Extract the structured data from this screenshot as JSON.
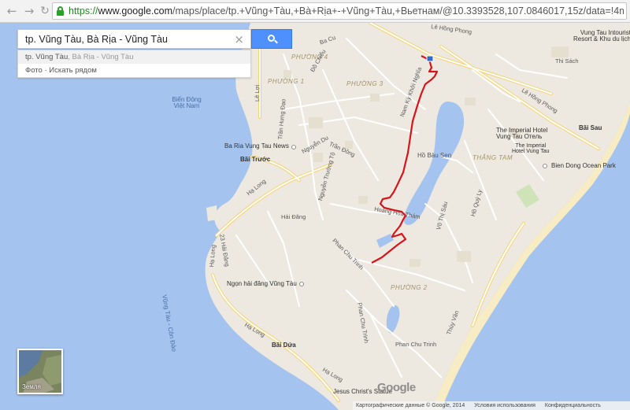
{
  "browser": {
    "back_icon": "back-arrow-icon",
    "forward_icon": "forward-arrow-icon",
    "url_scheme": "https://",
    "url_host": "www.google.com",
    "url_path": "/maps/place/tp.+Vũng+Tàu,+Bà+Rịa+-+Vũng+Tàu,+Вьетнам/@10.3393528,107.0846017,15z/data=!4m2!3m1!1s0x3175..."
  },
  "search": {
    "query": "tp. Vũng Tàu, Bà Rịa - Vũng Tàu",
    "clear_icon": "close-icon",
    "button_icon": "search-icon",
    "suggestions": [
      {
        "main": "tp. Vũng Tàu",
        "secondary": ", Bà Rịa - Vũng Tàu"
      },
      {
        "main": "Фото · Искать рядом",
        "secondary": ""
      }
    ]
  },
  "map": {
    "water_labels": [
      "Biển Đông Việt Nam",
      "Vũng Tàu - Côn Đảo",
      "Hồ Bàu Sen"
    ],
    "districts": [
      "PHƯỜNG 4",
      "PHƯỜNG 1",
      "PHƯỜNG 3",
      "PHƯỜNG 2",
      "THẮNG TAM"
    ],
    "streets": {
      "le_hong_phong_top": "Lê Hồng Phong",
      "le_hong_phong_right": "Lê Hồng Phong",
      "thi_sach": "Thi Sách",
      "ba_cu": "Ba Cu",
      "le_loi": "Lê Lợi",
      "do_chieu": "Đồ Chiểu",
      "tran_hung_dao": "Trần Hưng Đạo",
      "nguyen_du": "Nguyễn Du",
      "tran_dong": "Trần Đồng",
      "nguyen_truong_to": "Nguyễn Trường Tộ",
      "ha_long_1": "Hạ Long",
      "ha_long_2": "Hạ Long",
      "ha_long_3": "Hạ Long",
      "ha_long_4": "Hạ Long",
      "hai_dang": "Hải Đăng",
      "hai_dang_23": "23 Hải Đăng",
      "phan_chu_trinh_1": "Phan Chu Trinh",
      "phan_chu_trinh_2": "Phan Chu Trinh",
      "phan_chu_trinh_3": "Phan Chu Trinh",
      "thuy_van": "Thùy Vân",
      "vo_thi_sau": "Võ Thị Sáu",
      "ho_quy_ly": "Hồ Quý Ly",
      "hoang_hoa_tham": "Hoàng Hoa Thám",
      "nam_ky_khoi_nghia": "Nam Kỳ Khởi Nghĩa"
    },
    "pois": {
      "vung_tau_intourist": "Vung Tau Intourist",
      "intourist_2": "Resort & Khu du lịch",
      "imperial": "The Imperial Hotel",
      "imperial_2": "Vung Tau Отель",
      "imperial_3": "The Imperial",
      "imperial_4": "Hotel Vung Tau",
      "bien_dong_park": "Bien Dong Ocean Park",
      "bai_sau": "Bãi Sau",
      "ba_ria_news": "Ba Ria Vung Tau News",
      "bai_truoc": "Bãi Trước",
      "ngon_hai_dang": "Ngọn hải đăng Vũng Tàu",
      "bai_dua": "Bãi Dứa",
      "jesus": "Jesus Christ's Statue"
    },
    "route_color": "#d7141b",
    "water_color": "#a4c4ef",
    "land_color": "#ede9e0"
  },
  "earth_thumb": {
    "label": "Земля"
  },
  "logo": {
    "text": "Google"
  },
  "footer": {
    "copyright": "Картографические данные © Google, 2014",
    "terms": "Условия использования",
    "privacy": "Конфиденциальность"
  }
}
